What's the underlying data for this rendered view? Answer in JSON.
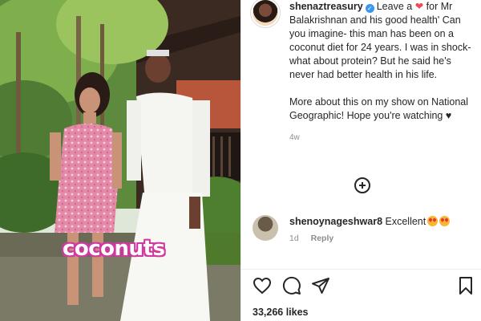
{
  "media": {
    "overlay_text": "coconuts"
  },
  "post": {
    "username": "shenaztreasury",
    "caption_lead": "Leave a",
    "caption_rest": " for Mr Balakrishnan and his good health' Can you imagine- this man has been on a coconut diet for 24 years. I was in shock- what about protein? But he said he's never had better health in his life.",
    "caption_para2": "More about this on my show on National Geographic! Hope you're watching ♥",
    "time": "4w",
    "heart_emoji": "❤"
  },
  "comment": {
    "username": "shenoynageshwar8",
    "text": "Excellent",
    "time": "1d",
    "reply_label": "Reply"
  },
  "footer": {
    "likes": "33,266 likes"
  },
  "icons": {
    "like": "heart-outline-icon",
    "comment": "comment-bubble-icon",
    "share": "send-paper-plane-icon",
    "save": "bookmark-icon",
    "load_more": "plus-circle-icon"
  },
  "colors": {
    "verified": "#3897f0",
    "heart": "#ed4956",
    "muted": "#8e8e8e",
    "overlay_outline": "#d03aa0"
  }
}
